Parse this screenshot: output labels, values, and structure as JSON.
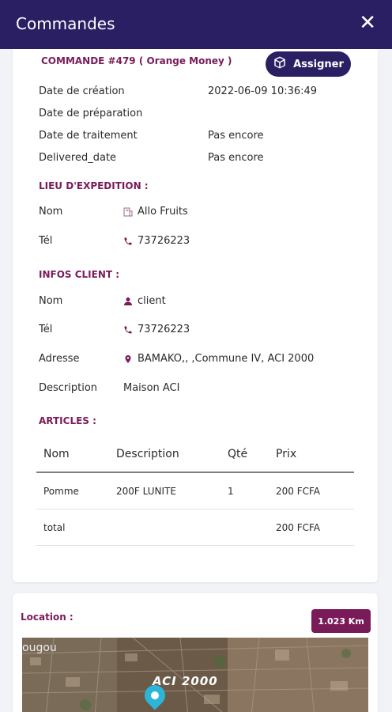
{
  "header": {
    "title": "Commandes",
    "close_glyph": "✕"
  },
  "order": {
    "title": "COMMANDE #479 ( Orange Money )",
    "assign_label": "Assigner",
    "dates": [
      {
        "label": "Date de création",
        "value": "2022-06-09 10:36:49"
      },
      {
        "label": "Date de préparation",
        "value": ""
      },
      {
        "label": "Date de traitement",
        "value": "Pas encore"
      },
      {
        "label": "Delivered_date",
        "value": "Pas encore"
      }
    ]
  },
  "expedition": {
    "title": "LIEU D'EXPEDITION :",
    "nom_label": "Nom",
    "nom_value": "Allo Fruits",
    "tel_label": "Tél",
    "tel_value": "73726223"
  },
  "client": {
    "title": "INFOS CLIENT :",
    "nom_label": "Nom",
    "nom_value": "client",
    "tel_label": "Tél",
    "tel_value": "73726223",
    "adresse_label": "Adresse",
    "adresse_value": "BAMAKO,, ,Commune IV, ACI 2000",
    "description_label": "Description",
    "description_value": "Maison ACI"
  },
  "articles": {
    "title": "ARTICLES :",
    "headers": [
      "Nom",
      "Description",
      "Qté",
      "Prix"
    ],
    "rows": [
      {
        "nom": "Pomme",
        "description": "200F LUNITE",
        "qte": "1",
        "prix": "200 FCFA"
      }
    ],
    "total_label": "total",
    "total_value": "200 FCFA"
  },
  "location": {
    "label": "Location :",
    "distance": "1.023 Km",
    "map_label_area": "ACI 2000",
    "map_label_town": "ougou"
  },
  "icons": {
    "close": "close-icon",
    "assign": "box-icon",
    "store": "building-icon",
    "phone": "phone-icon",
    "user": "user-icon",
    "location": "map-pin-icon"
  },
  "colors": {
    "primary": "#2a1f63",
    "accent": "#7a1b59",
    "pin": "#2bb6d9"
  }
}
